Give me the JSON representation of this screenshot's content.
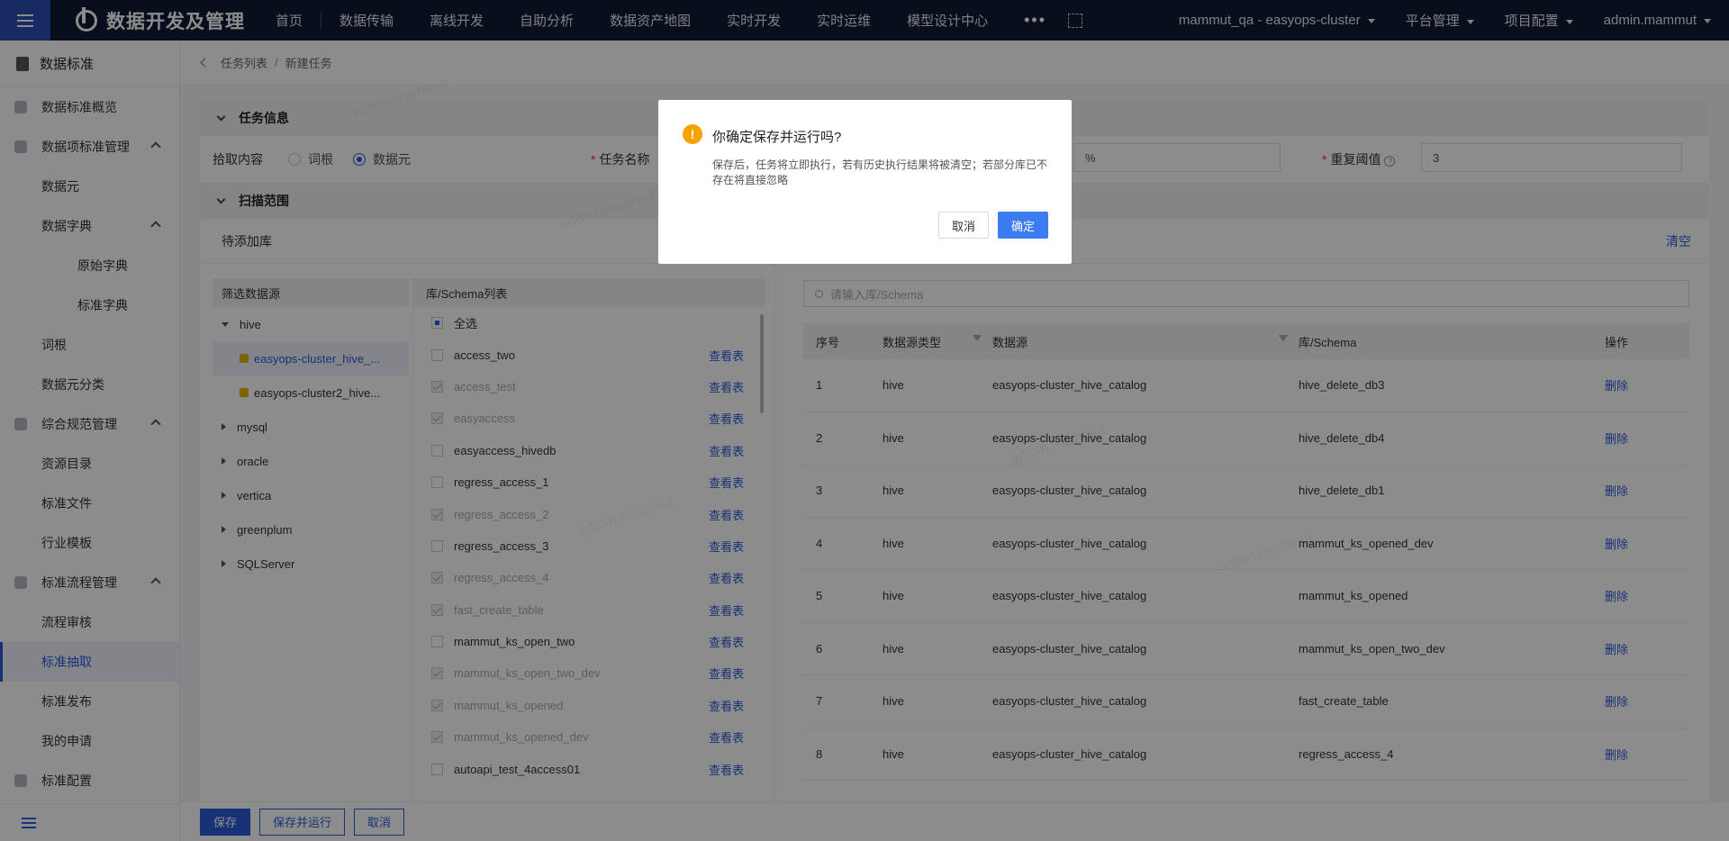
{
  "topbar": {
    "app_title": "数据开发及管理",
    "nav": [
      "首页",
      "数据传输",
      "离线开发",
      "自助分析",
      "数据资产地图",
      "实时开发",
      "实时运维",
      "模型设计中心"
    ],
    "more": "•••",
    "right": [
      "mammut_qa - easyops-cluster",
      "平台管理",
      "项目配置",
      "admin.mammut"
    ]
  },
  "sidebar": {
    "header": "数据标准",
    "items": [
      {
        "label": "数据标准概览",
        "level": 1,
        "icon": "monitor-icon"
      },
      {
        "label": "数据项标准管理",
        "level": 1,
        "icon": "shield-icon",
        "expanded": true
      },
      {
        "label": "数据元",
        "level": 2
      },
      {
        "label": "数据字典",
        "level": 2,
        "expanded": true
      },
      {
        "label": "原始字典",
        "level": 3
      },
      {
        "label": "标准字典",
        "level": 3
      },
      {
        "label": "词根",
        "level": 2
      },
      {
        "label": "数据元分类",
        "level": 2
      },
      {
        "label": "综合规范管理",
        "level": 1,
        "icon": "doc-icon",
        "expanded": true
      },
      {
        "label": "资源目录",
        "level": 2
      },
      {
        "label": "标准文件",
        "level": 2
      },
      {
        "label": "行业模板",
        "level": 2
      },
      {
        "label": "标准流程管理",
        "level": 1,
        "icon": "flow-icon",
        "expanded": true
      },
      {
        "label": "流程审核",
        "level": 2
      },
      {
        "label": "标准抽取",
        "level": 2,
        "active": true
      },
      {
        "label": "标准发布",
        "level": 2
      },
      {
        "label": "我的申请",
        "level": 2
      },
      {
        "label": "标准配置",
        "level": 1,
        "icon": "gear-icon"
      }
    ]
  },
  "breadcrumb": {
    "parent": "任务列表",
    "current": "新建任务"
  },
  "task_info": {
    "section_title": "任务信息",
    "extract_label": "拾取内容",
    "radio_root": "词根",
    "radio_element": "数据元",
    "task_name_label": "任务名称",
    "percent_value": "%",
    "repeat_label": "重复阈值",
    "repeat_value": "3"
  },
  "scan": {
    "section_title": "扫描范围",
    "left_title": "待添加库",
    "clear": "清空",
    "source_header": "筛选数据源",
    "tree": [
      {
        "label": "hive",
        "expanded": true
      },
      {
        "label": "easyops-cluster_hive_...",
        "child": true,
        "selected": true
      },
      {
        "label": "easyops-cluster2_hive...",
        "child": true
      },
      {
        "label": "mysql"
      },
      {
        "label": "oracle"
      },
      {
        "label": "vertica"
      },
      {
        "label": "greenplum"
      },
      {
        "label": "SQLServer"
      }
    ],
    "schema_header": "库/Schema列表",
    "select_all": "全选",
    "view_table": "查看表",
    "schemas": [
      {
        "name": "access_two",
        "disabled": false
      },
      {
        "name": "access_test",
        "disabled": true
      },
      {
        "name": "easyaccess",
        "disabled": true
      },
      {
        "name": "easyaccess_hivedb",
        "disabled": false
      },
      {
        "name": "regress_access_1",
        "disabled": false
      },
      {
        "name": "regress_access_2",
        "disabled": true
      },
      {
        "name": "regress_access_3",
        "disabled": false
      },
      {
        "name": "regress_access_4",
        "disabled": true
      },
      {
        "name": "fast_create_table",
        "disabled": true
      },
      {
        "name": "mammut_ks_open_two",
        "disabled": false
      },
      {
        "name": "mammut_ks_open_two_dev",
        "disabled": true
      },
      {
        "name": "mammut_ks_opened",
        "disabled": true
      },
      {
        "name": "mammut_ks_opened_dev",
        "disabled": true
      },
      {
        "name": "autoapi_test_4access01",
        "disabled": false
      }
    ],
    "search_placeholder": "请输入库/Schema",
    "table_headers": [
      "序号",
      "数据源类型",
      "数据源",
      "库/Schema",
      "操作"
    ],
    "rows": [
      [
        "1",
        "hive",
        "easyops-cluster_hive_catalog",
        "hive_delete_db3",
        "删除"
      ],
      [
        "2",
        "hive",
        "easyops-cluster_hive_catalog",
        "hive_delete_db4",
        "删除"
      ],
      [
        "3",
        "hive",
        "easyops-cluster_hive_catalog",
        "hive_delete_db1",
        "删除"
      ],
      [
        "4",
        "hive",
        "easyops-cluster_hive_catalog",
        "mammut_ks_opened_dev",
        "删除"
      ],
      [
        "5",
        "hive",
        "easyops-cluster_hive_catalog",
        "mammut_ks_opened",
        "删除"
      ],
      [
        "6",
        "hive",
        "easyops-cluster_hive_catalog",
        "mammut_ks_open_two_dev",
        "删除"
      ],
      [
        "7",
        "hive",
        "easyops-cluster_hive_catalog",
        "fast_create_table",
        "删除"
      ],
      [
        "8",
        "hive",
        "easyops-cluster_hive_catalog",
        "regress_access_4",
        "删除"
      ]
    ]
  },
  "footer": {
    "save": "保存",
    "save_run": "保存并运行",
    "cancel": "取消"
  },
  "watermark": "admin.mammut",
  "dialog": {
    "title": "你确定保存并运行吗?",
    "body": "保存后，任务将立即执行，若有历史执行结果将被清空；若部分库已不存在将直接忽略",
    "cancel": "取消",
    "ok": "确定",
    "icon": "warning-icon"
  },
  "colors": {
    "primary": "#2a5bd7",
    "topbar": "#0f1a33",
    "warning": "#f5a300",
    "dialog_ok": "#3d7bf2"
  }
}
